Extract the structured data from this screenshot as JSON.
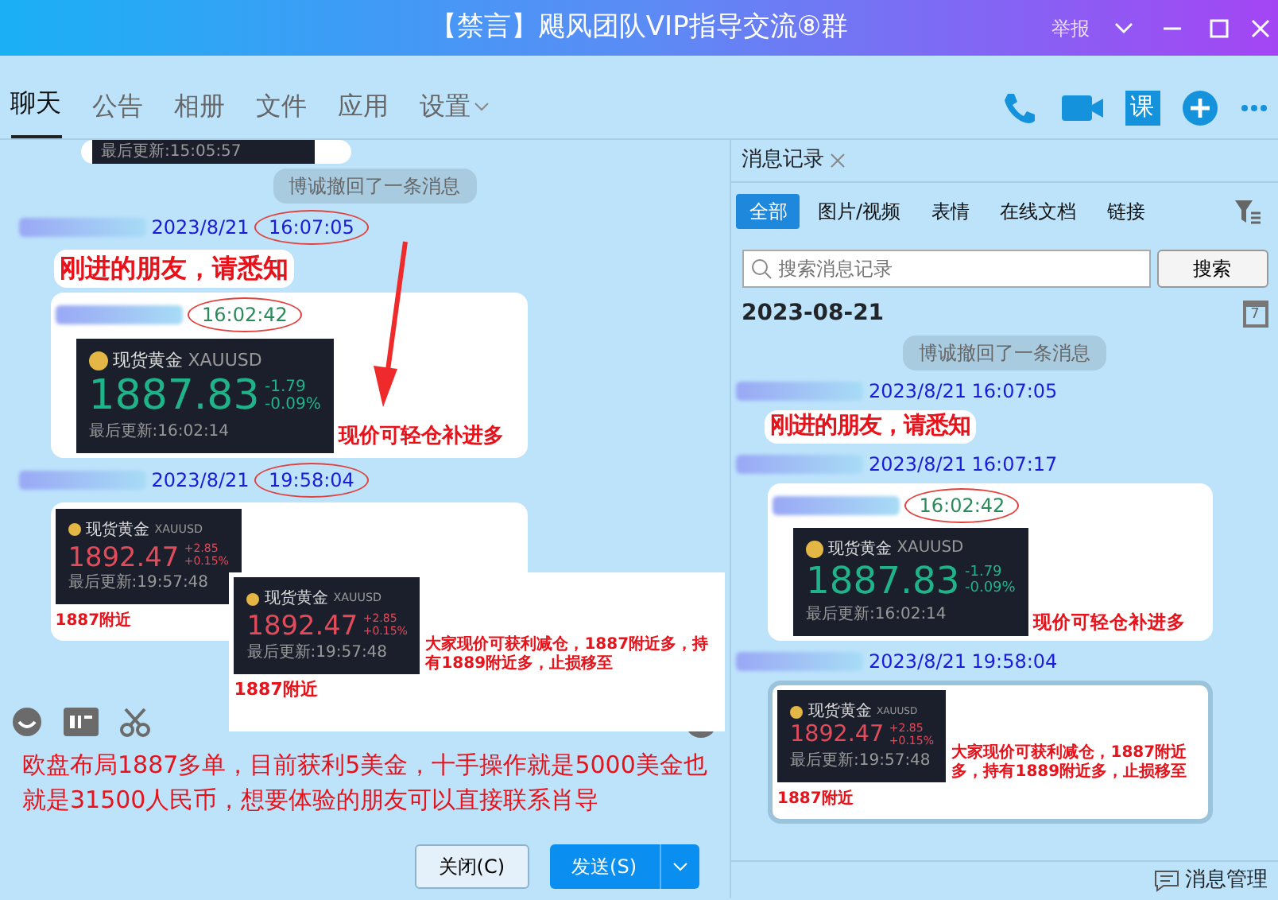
{
  "window": {
    "title": "【禁言】飓风团队VIP指导交流⑧群",
    "report": "举报"
  },
  "tabs": [
    {
      "label": "聊天",
      "selected": true
    },
    {
      "label": "公告",
      "selected": false
    },
    {
      "label": "相册",
      "selected": false
    },
    {
      "label": "文件",
      "selected": false
    },
    {
      "label": "应用",
      "selected": false
    },
    {
      "label": "设置",
      "selected": false,
      "dropdown": true
    }
  ],
  "toolbar": {
    "course": "课"
  },
  "chat": {
    "partial_update": "最后更新:15:05:57",
    "items": [
      {
        "kind": "notice",
        "text": "博诚撤回了一条消息"
      },
      {
        "kind": "text",
        "date": "2023/8/21",
        "time": "16:07:05",
        "circled": true,
        "text": "刚进的朋友，请悉知"
      },
      {
        "kind": "quote",
        "header_time": "16:02:42",
        "quote": {
          "name": "现货黄金",
          "symbol": "XAUUSD",
          "price": "1887.83",
          "change": "-1.79",
          "pct": "-0.09%",
          "updated": "最后更新:16:02:14",
          "rising": false
        },
        "caption": "现价可轻仓补进多"
      },
      {
        "kind": "image",
        "date": "2023/8/21",
        "time": "19:58:04",
        "circled": true,
        "quote": {
          "name": "现货黄金",
          "symbol": "XAUUSD",
          "price": "1892.47",
          "change": "+2.85",
          "pct": "+0.15%",
          "updated": "最后更新:19:57:48",
          "rising": true
        },
        "caption": "1887附近"
      }
    ]
  },
  "popup": {
    "quote": {
      "name": "现货黄金",
      "symbol": "XAUUSD",
      "price": "1892.47",
      "change": "+2.85",
      "pct": "+0.15%",
      "updated": "最后更新:19:57:48",
      "rising": true
    },
    "caption": "大家现价可获利减仓，1887附近多，持有1889附近多，止损移至",
    "caption2": "1887附近"
  },
  "input": {
    "text": "欧盘布局1887多单，目前获利5美金，十手操作就是5000美金也就是31500人民币，想要体验的朋友可以直接联系肖导"
  },
  "buttons": {
    "close": "关闭(C)",
    "send": "发送(S)"
  },
  "history": {
    "tab": "消息记录",
    "filters": [
      {
        "label": "全部",
        "selected": true
      },
      {
        "label": "图片/视频",
        "selected": false
      },
      {
        "label": "表情",
        "selected": false
      },
      {
        "label": "在线文档",
        "selected": false
      },
      {
        "label": "链接",
        "selected": false
      }
    ],
    "search_placeholder": "搜索消息记录",
    "search_button": "搜索",
    "date": "2023-08-21",
    "calendar_day": "7",
    "items": [
      {
        "kind": "notice",
        "text": "博诚撤回了一条消息"
      },
      {
        "kind": "text",
        "date": "2023/8/21",
        "time": "16:07:05",
        "text": "刚进的朋友，请悉知"
      },
      {
        "kind": "quote",
        "date": "2023/8/21",
        "time": "16:07:17",
        "header_time": "16:02:42",
        "quote": {
          "name": "现货黄金",
          "symbol": "XAUUSD",
          "price": "1887.83",
          "change": "-1.79",
          "pct": "-0.09%",
          "updated": "最后更新:16:02:14",
          "rising": false
        },
        "caption": "现价可轻仓补进多"
      },
      {
        "kind": "image",
        "date": "2023/8/21",
        "time": "19:58:04",
        "quote": {
          "name": "现货黄金",
          "symbol": "XAUUSD",
          "price": "1892.47",
          "change": "+2.85",
          "pct": "+0.15%",
          "updated": "最后更新:19:57:48",
          "rising": true
        },
        "caption": "大家现价可获利减仓，1887附近多，持有1889附近多，止损移至",
        "caption2": "1887附近"
      }
    ],
    "footer": "消息管理"
  }
}
